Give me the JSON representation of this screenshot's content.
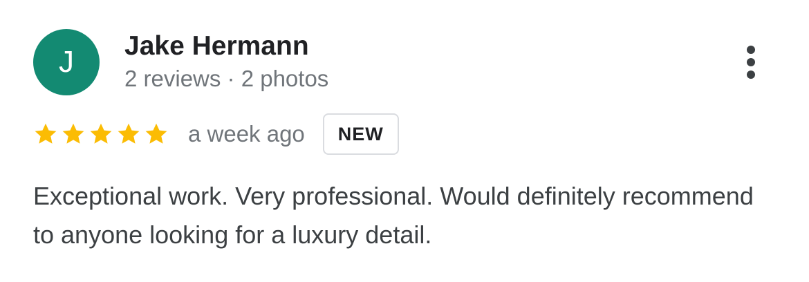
{
  "review": {
    "author": {
      "initial": "J",
      "name": "Jake Hermann",
      "meta": "2 reviews · 2 photos",
      "avatar_color": "#138a72"
    },
    "more_icon": "more-vert-icon",
    "rating": 5,
    "rating_max": 5,
    "star_color": "#fbbc04",
    "time_ago": "a week ago",
    "badge": "NEW",
    "text": "Exceptional work. Very professional. Would definitely recommend to anyone looking for a luxury detail."
  }
}
